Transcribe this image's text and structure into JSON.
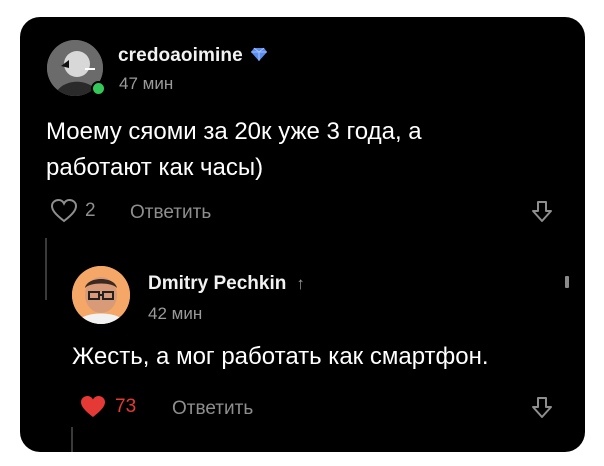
{
  "comment": {
    "username": "credoaoimine",
    "time": "47 мин",
    "text_line1": "Моему сяоми за 20к уже 3 года, а",
    "text_line2": "работают как часы)",
    "likes": "2",
    "reply_label": "Ответить",
    "badge_color": "#5b8def"
  },
  "reply": {
    "username": "Dmitry Pechkin",
    "time": "42 мин",
    "text": "Жесть, а мог работать как смартфон.",
    "likes": "73",
    "reply_label": "Ответить",
    "heart_color": "#e53935"
  }
}
